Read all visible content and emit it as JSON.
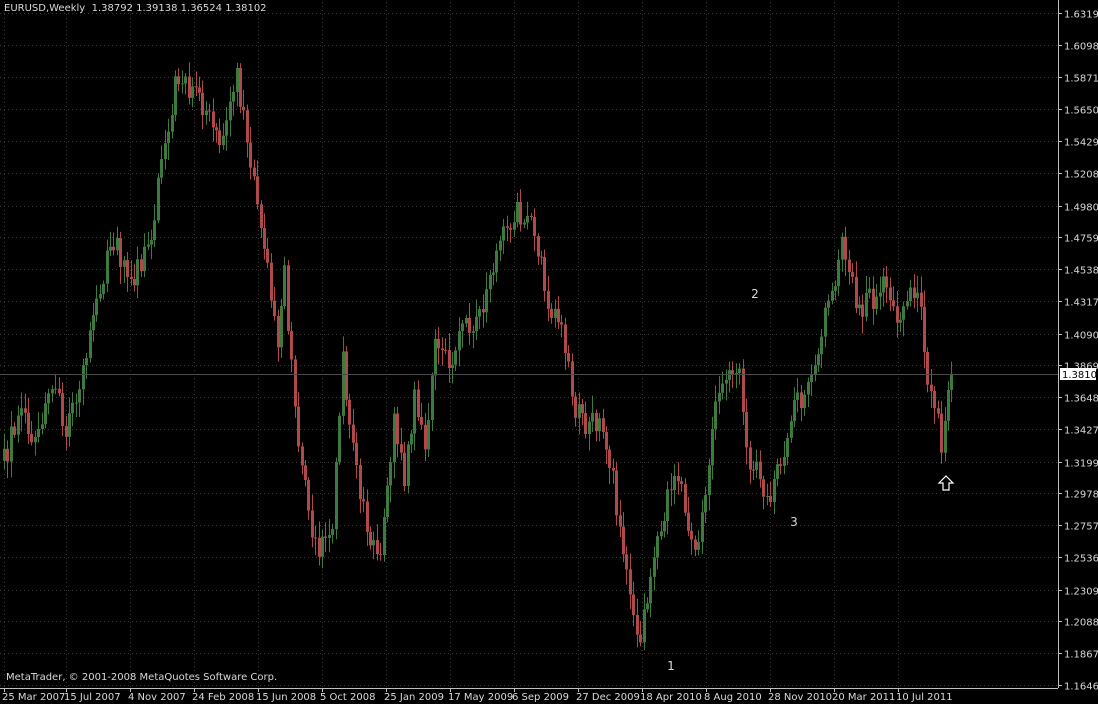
{
  "header": {
    "symbol": "EURUSD,Weekly",
    "ohlc": "1.38792 1.39138 1.36524 1.38102"
  },
  "footer": {
    "copyright": "MetaTrader, © 2001-2008 MetaQuotes Software Corp."
  },
  "colors": {
    "background": "#000000",
    "grid": "#3a3a3a",
    "axis": "#c0c0c0",
    "text": "#d8d8d8",
    "bull": "#3d7a3d",
    "bear": "#b04a4a",
    "wick_bull": "#3d7a3d",
    "wick_bear": "#b04a4a"
  },
  "chart_data": {
    "type": "candlestick",
    "title": "EURUSD,Weekly",
    "ylim": [
      1.1646,
      1.63195
    ],
    "y_ticks": [
      "1.63195",
      "1.60985",
      "1.58710",
      "1.56500",
      "1.54290",
      "1.52080",
      "1.49805",
      "1.47595",
      "1.45385",
      "1.43175",
      "1.40900",
      "1.38690",
      "1.36480",
      "1.34270",
      "1.31995",
      "1.29785",
      "1.27575",
      "1.25365",
      "1.23090",
      "1.20880",
      "1.18670",
      "1.16460"
    ],
    "x_ticks": [
      "25 Mar 2007",
      "15 Jul 2007",
      "4 Nov 2007",
      "24 Feb 2008",
      "15 Jun 2008",
      "5 Oct 2008",
      "25 Jan 2009",
      "17 May 2009",
      "6 Sep 2009",
      "27 Dec 2009",
      "18 Apr 2010",
      "8 Aug 2010",
      "28 Nov 2010",
      "20 Mar 2011",
      "10 Jul 2011"
    ],
    "current_price": "1.38102",
    "pivots": [
      {
        "label": "1",
        "date": "Jun 2010",
        "price": 1.1876
      },
      {
        "label": "2",
        "date": "Nov 2010",
        "price": 1.4282
      },
      {
        "label": "3",
        "date": "Jan 2011",
        "price": 1.2868
      }
    ],
    "arrow": {
      "icon": "up-arrow-icon",
      "date": "Sep 2011",
      "price": 1.3065
    },
    "path": [
      [
        0,
        1.3205
      ],
      [
        5,
        1.3585
      ],
      [
        9,
        1.3355
      ],
      [
        14,
        1.378
      ],
      [
        18,
        1.342
      ],
      [
        24,
        1.395
      ],
      [
        31,
        1.475
      ],
      [
        38,
        1.45
      ],
      [
        43,
        1.478
      ],
      [
        47,
        1.542
      ],
      [
        50,
        1.582
      ],
      [
        57,
        1.575
      ],
      [
        63,
        1.54
      ],
      [
        68,
        1.588
      ],
      [
        71,
        1.545
      ],
      [
        75,
        1.485
      ],
      [
        80,
        1.405
      ],
      [
        82,
        1.45
      ],
      [
        85,
        1.35
      ],
      [
        89,
        1.285
      ],
      [
        92,
        1.255
      ],
      [
        96,
        1.28
      ],
      [
        99,
        1.39
      ],
      [
        102,
        1.33
      ],
      [
        106,
        1.27
      ],
      [
        110,
        1.26
      ],
      [
        114,
        1.35
      ],
      [
        117,
        1.305
      ],
      [
        120,
        1.365
      ],
      [
        123,
        1.33
      ],
      [
        126,
        1.4
      ],
      [
        130,
        1.39
      ],
      [
        134,
        1.415
      ],
      [
        138,
        1.42
      ],
      [
        142,
        1.445
      ],
      [
        146,
        1.48
      ],
      [
        150,
        1.495
      ],
      [
        154,
        1.485
      ],
      [
        157,
        1.455
      ],
      [
        160,
        1.425
      ],
      [
        163,
        1.415
      ],
      [
        166,
        1.365
      ],
      [
        170,
        1.34
      ],
      [
        174,
        1.35
      ],
      [
        178,
        1.31
      ],
      [
        181,
        1.25
      ],
      [
        184,
        1.22
      ],
      [
        186,
        1.19
      ],
      [
        188,
        1.23
      ],
      [
        191,
        1.265
      ],
      [
        194,
        1.295
      ],
      [
        197,
        1.315
      ],
      [
        200,
        1.27
      ],
      [
        203,
        1.265
      ],
      [
        206,
        1.32
      ],
      [
        209,
        1.37
      ],
      [
        212,
        1.39
      ],
      [
        215,
        1.38
      ],
      [
        218,
        1.315
      ],
      [
        221,
        1.31
      ],
      [
        224,
        1.29
      ],
      [
        227,
        1.32
      ],
      [
        230,
        1.35
      ],
      [
        233,
        1.365
      ],
      [
        236,
        1.385
      ],
      [
        239,
        1.41
      ],
      [
        242,
        1.44
      ],
      [
        245,
        1.47
      ],
      [
        248,
        1.44
      ],
      [
        251,
        1.425
      ],
      [
        254,
        1.435
      ],
      [
        257,
        1.445
      ],
      [
        260,
        1.42
      ],
      [
        263,
        1.43
      ],
      [
        266,
        1.44
      ],
      [
        268,
        1.43
      ],
      [
        270,
        1.375
      ],
      [
        272,
        1.355
      ],
      [
        274,
        1.335
      ],
      [
        276,
        1.365
      ],
      [
        277,
        1.381
      ]
    ]
  }
}
